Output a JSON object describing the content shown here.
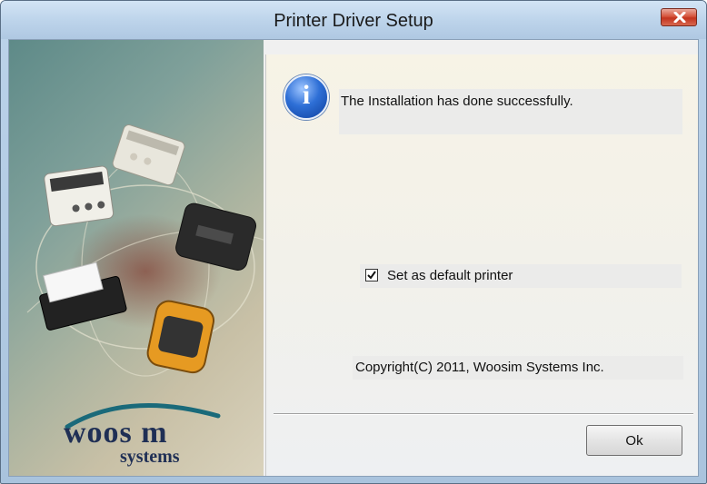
{
  "window": {
    "title": "Printer Driver Setup",
    "close_icon": "close-icon"
  },
  "banner": {
    "logo_main": "woos m",
    "logo_sub": "systems"
  },
  "dialog": {
    "message": "The Installation has done successfully.",
    "info_icon": "info-icon",
    "info_glyph": "i",
    "default_checkbox": {
      "label": "Set as default printer",
      "checked": true
    },
    "copyright": "Copyright(C) 2011, Woosim Systems Inc.",
    "ok_label": "Ok"
  },
  "colors": {
    "accent": "#2e6fd6",
    "close": "#c3341e",
    "logo": "#1f2f55"
  }
}
